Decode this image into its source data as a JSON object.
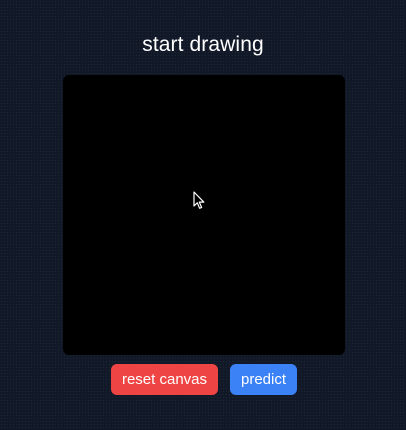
{
  "header": {
    "title": "start drawing"
  },
  "canvas": {
    "cursor_icon": "mouse-pointer-icon"
  },
  "buttons": {
    "reset_label": "reset canvas",
    "predict_label": "predict"
  },
  "colors": {
    "background": "#111827",
    "canvas": "#000000",
    "reset_button": "#ef4444",
    "predict_button": "#3b82f6",
    "text": "#ffffff"
  }
}
